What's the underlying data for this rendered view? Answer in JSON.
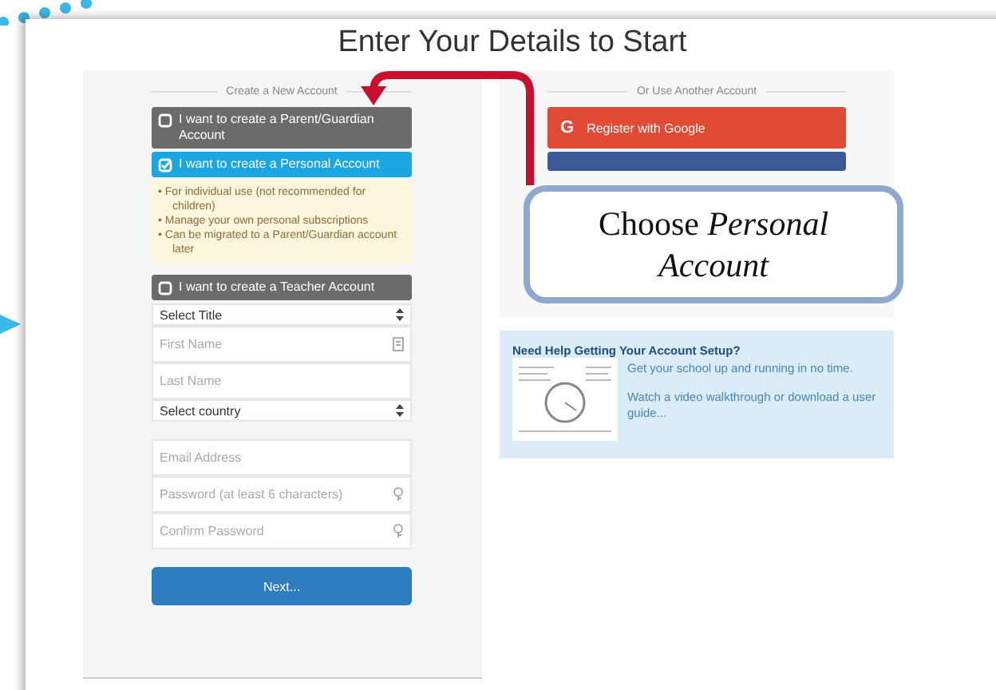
{
  "page_title": "Enter Your Details to Start",
  "signup": {
    "heading": "Create a New Account",
    "options": [
      {
        "label": "I want to create a Parent/Guardian Account",
        "selected": false
      },
      {
        "label": "I want to create a Personal Account",
        "selected": true,
        "notes": [
          "• For individual use (not recommended for children)",
          "• Manage your own personal subscriptions",
          "• Can be migrated to a Parent/Guardian account later"
        ]
      },
      {
        "label": "I want to create a Teacher Account",
        "selected": false
      }
    ],
    "profile_fields": [
      {
        "kind": "select",
        "value": "Select Title"
      },
      {
        "kind": "name",
        "placeholder": "First Name"
      },
      {
        "kind": "text",
        "placeholder": "Last Name"
      },
      {
        "kind": "select",
        "value": "Select country"
      }
    ],
    "login_fields": [
      {
        "kind": "text",
        "placeholder": "Email Address"
      },
      {
        "kind": "secret",
        "placeholder": "Password (at least 6 characters)"
      },
      {
        "kind": "secret",
        "placeholder": "Confirm Password"
      }
    ],
    "submit": "Next..."
  },
  "other": {
    "heading": "Or Use Another Account",
    "google": {
      "icon": "G",
      "label": "Register with Google"
    }
  },
  "help": {
    "title": "Need Help Getting Your Account Setup?",
    "lines": [
      "Get your school up and running in no time.",
      "Watch a video walkthrough or download a user guide..."
    ]
  },
  "callout": {
    "text": "Choose *Personal Account*"
  }
}
